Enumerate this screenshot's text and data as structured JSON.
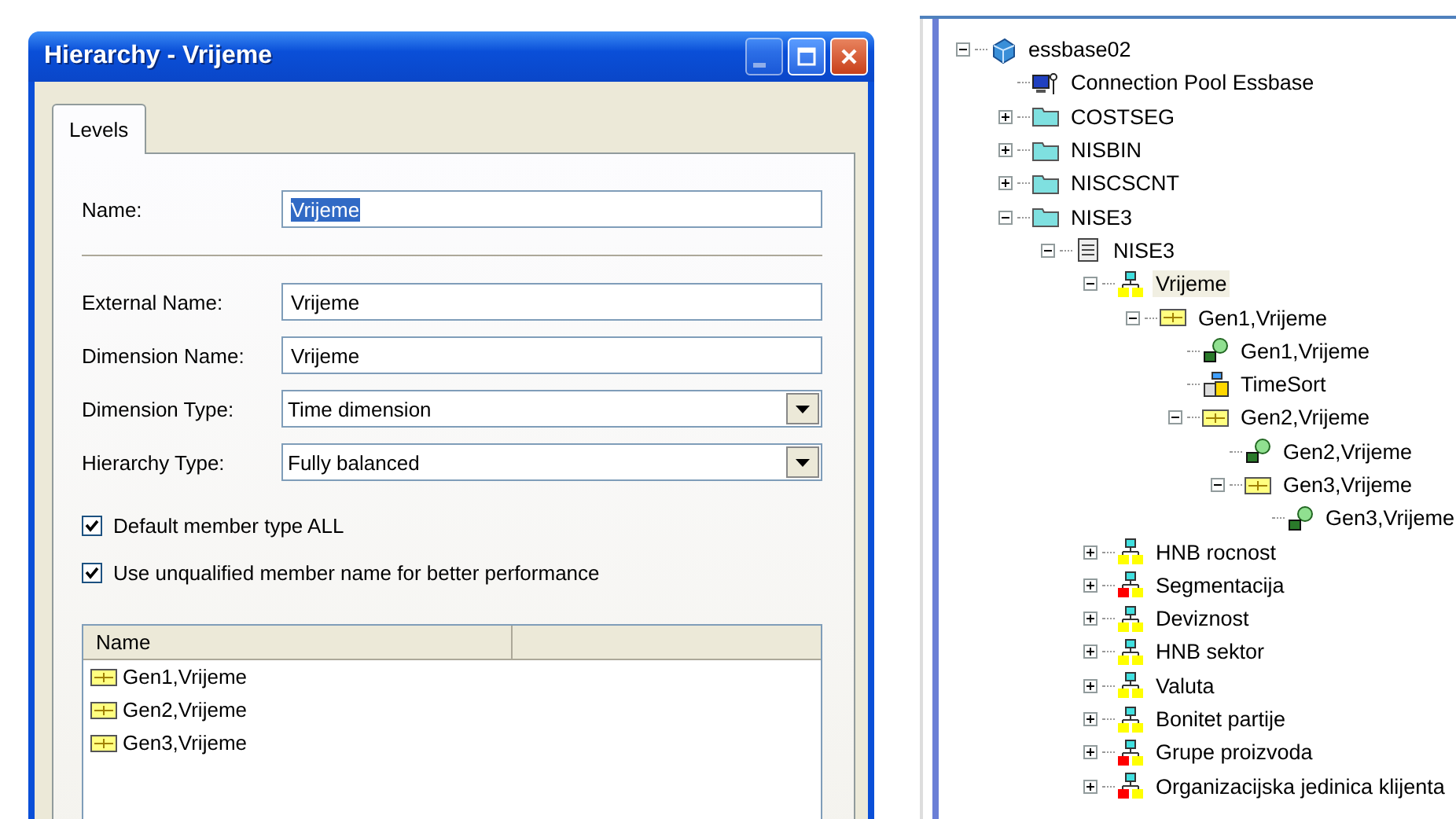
{
  "dialog": {
    "title": "Hierarchy - Vrijeme",
    "window_buttons": [
      {
        "kind": "minimize",
        "disabled": true
      },
      {
        "kind": "maximize",
        "disabled": false
      },
      {
        "kind": "close",
        "disabled": false
      }
    ],
    "tabs": [
      {
        "label": "Levels",
        "selected": true
      }
    ],
    "name_field": {
      "label": "Name:",
      "value": "Vrijeme",
      "text_selected": true
    },
    "fields": [
      {
        "kind": "text",
        "label": "External Name:",
        "value": "Vrijeme"
      },
      {
        "kind": "text",
        "label": "Dimension Name:",
        "value": "Vrijeme"
      },
      {
        "kind": "dropdown",
        "label": "Dimension Type:",
        "value": "Time dimension"
      },
      {
        "kind": "dropdown",
        "label": "Hierarchy Type:",
        "value": "Fully balanced"
      }
    ],
    "checkboxes": [
      {
        "label": "Default member type ALL",
        "checked": true
      },
      {
        "label": "Use unqualified member name for better performance",
        "checked": true
      }
    ],
    "levels_list": {
      "columns": [
        "Name"
      ],
      "rows": [
        "Gen1,Vrijeme",
        "Gen2,Vrijeme",
        "Gen3,Vrijeme"
      ]
    }
  },
  "tree": [
    {
      "kind": "server",
      "label": "essbase02",
      "expanded": true,
      "selected": false,
      "children": [
        {
          "kind": "connection",
          "label": "Connection Pool Essbase",
          "selected": false
        },
        {
          "kind": "folder",
          "label": "COSTSEG",
          "expanded": false,
          "selected": false
        },
        {
          "kind": "folder",
          "label": "NISBIN",
          "expanded": false,
          "selected": false
        },
        {
          "kind": "folder",
          "label": "NISCSCNT",
          "expanded": false,
          "selected": false
        },
        {
          "kind": "folder",
          "label": "NISE3",
          "expanded": true,
          "selected": false,
          "children": [
            {
              "kind": "database",
              "label": "NISE3",
              "expanded": true,
              "selected": false,
              "children": [
                {
                  "kind": "hierarchy",
                  "label": "Vrijeme",
                  "color": "#ffff00",
                  "expanded": true,
                  "selected": true,
                  "children": [
                    {
                      "kind": "level",
                      "label": "Gen1,Vrijeme",
                      "expanded": true,
                      "selected": false,
                      "children": [
                        {
                          "kind": "key",
                          "label": "Gen1,Vrijeme",
                          "selected": false
                        },
                        {
                          "kind": "sort",
                          "label": "TimeSort",
                          "selected": false
                        },
                        {
                          "kind": "level",
                          "label": "Gen2,Vrijeme",
                          "expanded": true,
                          "selected": false,
                          "children": [
                            {
                              "kind": "key",
                              "label": "Gen2,Vrijeme",
                              "selected": false
                            },
                            {
                              "kind": "level",
                              "label": "Gen3,Vrijeme",
                              "expanded": true,
                              "selected": false,
                              "children": [
                                {
                                  "kind": "key",
                                  "label": "Gen3,Vrijeme",
                                  "selected": false
                                }
                              ]
                            }
                          ]
                        }
                      ]
                    }
                  ]
                },
                {
                  "kind": "hierarchy",
                  "label": "HNB rocnost",
                  "color": "#ffff00",
                  "expanded": false,
                  "selected": false
                },
                {
                  "kind": "hierarchy",
                  "label": "Segmentacija",
                  "color": "#ff0000",
                  "expanded": false,
                  "selected": false
                },
                {
                  "kind": "hierarchy",
                  "label": "Deviznost",
                  "color": "#ffff00",
                  "expanded": false,
                  "selected": false
                },
                {
                  "kind": "hierarchy",
                  "label": "HNB sektor",
                  "color": "#ffff00",
                  "expanded": false,
                  "selected": false
                },
                {
                  "kind": "hierarchy",
                  "label": "Valuta",
                  "color": "#ffff00",
                  "expanded": false,
                  "selected": false
                },
                {
                  "kind": "hierarchy",
                  "label": "Bonitet partije",
                  "color": "#ffff00",
                  "expanded": false,
                  "selected": false
                },
                {
                  "kind": "hierarchy",
                  "label": "Grupe proizvoda",
                  "color": "#ff0000",
                  "expanded": false,
                  "selected": false
                },
                {
                  "kind": "hierarchy",
                  "label": "Organizacijska jedinica klijenta",
                  "color": "#ff0000",
                  "expanded": false,
                  "selected": false
                }
              ]
            }
          ]
        }
      ]
    }
  ]
}
